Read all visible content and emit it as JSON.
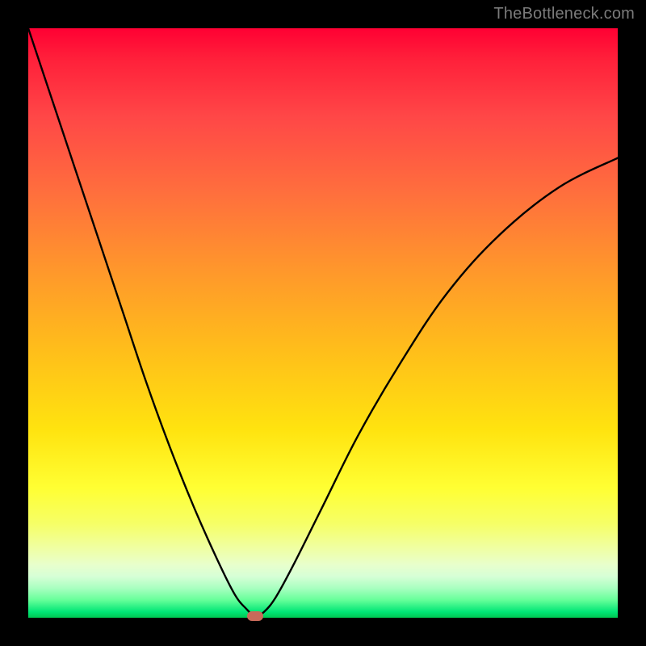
{
  "watermark": {
    "text": "TheBottleneck.com"
  },
  "colors": {
    "gradient_top": "#ff0033",
    "gradient_bottom": "#00c853",
    "curve": "#000000",
    "marker": "#c96a5a",
    "frame": "#000000"
  },
  "chart_data": {
    "type": "line",
    "title": "",
    "xlabel": "",
    "ylabel": "",
    "xlim": [
      0,
      100
    ],
    "ylim": [
      0,
      100
    ],
    "grid": false,
    "legend": false,
    "series": [
      {
        "name": "bottleneck-curve",
        "x": [
          0,
          4,
          8,
          12,
          16,
          20,
          24,
          28,
          32,
          35,
          37,
          38.5,
          40,
          42,
          45,
          50,
          56,
          63,
          71,
          80,
          90,
          100
        ],
        "y": [
          100,
          88,
          76,
          64,
          52,
          40,
          29,
          19,
          10,
          4,
          1.5,
          0.3,
          1,
          3.5,
          9,
          19,
          31,
          43,
          55,
          65,
          73,
          78
        ]
      }
    ],
    "marker": {
      "x": 38.5,
      "y": 0.3
    },
    "notes": "V-shaped curve over a vertical red→green gradient; minimum (marker) near x≈38.5%. Values estimated from pixel positions; chart has no axes or tick labels."
  }
}
